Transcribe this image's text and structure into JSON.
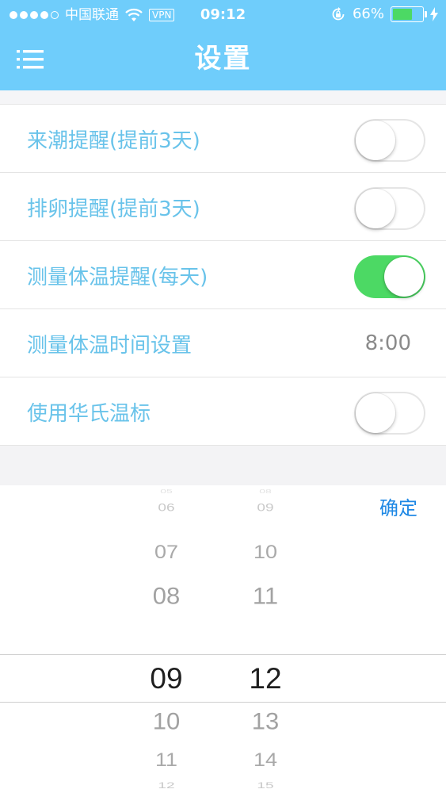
{
  "status_bar": {
    "carrier": "中国联通",
    "vpn": "VPN",
    "time": "09:12",
    "battery_percent": "66%",
    "battery_level": 0.66,
    "battery_color": "#4cd964"
  },
  "header": {
    "title": "设置",
    "menu_icon": "list-menu-icon",
    "background_color": "#6fcdfb"
  },
  "settings": [
    {
      "label": "来潮提醒(提前3天)",
      "type": "toggle",
      "on": false
    },
    {
      "label": "排卵提醒(提前3天)",
      "type": "toggle",
      "on": false
    },
    {
      "label": "测量体温提醒(每天)",
      "type": "toggle",
      "on": true
    },
    {
      "label": "测量体温时间设置",
      "type": "value",
      "value": "8:00"
    },
    {
      "label": "使用华氏温标",
      "type": "toggle",
      "on": false
    }
  ],
  "picker": {
    "confirm_label": "确定",
    "hours": [
      "05",
      "06",
      "07",
      "08",
      "09",
      "10",
      "11",
      "12"
    ],
    "minutes": [
      "08",
      "09",
      "10",
      "11",
      "12",
      "13",
      "14",
      "15"
    ],
    "selected_hour": "09",
    "selected_minute": "12"
  },
  "colors": {
    "accent": "#6fcdfb",
    "label": "#69c3ea",
    "toggle_on": "#4cd964",
    "confirm": "#1e88e5"
  }
}
